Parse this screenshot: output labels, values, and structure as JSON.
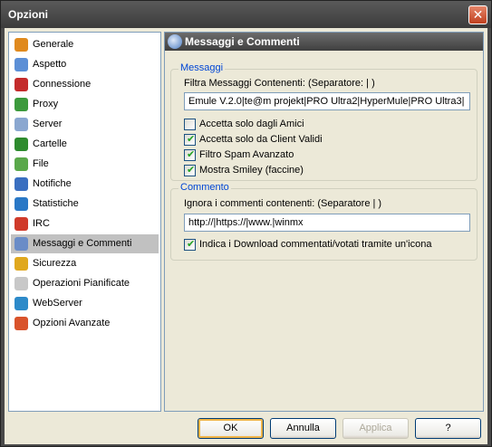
{
  "window": {
    "title": "Opzioni",
    "close_glyph": "✕"
  },
  "nav": {
    "items": [
      {
        "label": "Generale",
        "icon": "gear-icon",
        "color": "#e08a1e"
      },
      {
        "label": "Aspetto",
        "icon": "monitor-icon",
        "color": "#5c8fd6"
      },
      {
        "label": "Connessione",
        "icon": "plug-icon",
        "color": "#c42b2b"
      },
      {
        "label": "Proxy",
        "icon": "proxy-icon",
        "color": "#3c9a3c"
      },
      {
        "label": "Server",
        "icon": "server-icon",
        "color": "#8aa7d0"
      },
      {
        "label": "Cartelle",
        "icon": "folder-icon",
        "color": "#2e8b2e"
      },
      {
        "label": "File",
        "icon": "file-icon",
        "color": "#5aa84a"
      },
      {
        "label": "Notifiche",
        "icon": "notification-icon",
        "color": "#3a6fc0"
      },
      {
        "label": "Statistiche",
        "icon": "statistics-icon",
        "color": "#2a78c6"
      },
      {
        "label": "IRC",
        "icon": "irc-icon",
        "color": "#d03a2a"
      },
      {
        "label": "Messaggi e Commenti",
        "icon": "messages-icon",
        "color": "#6a8cc7"
      },
      {
        "label": "Sicurezza",
        "icon": "lock-icon",
        "color": "#e0a81e"
      },
      {
        "label": "Operazioni Pianificate",
        "icon": "calendar-icon",
        "color": "#c8c8c8"
      },
      {
        "label": "WebServer",
        "icon": "globe-icon",
        "color": "#2d8ac9"
      },
      {
        "label": "Opzioni Avanzate",
        "icon": "advanced-options-icon",
        "color": "#d9532b"
      }
    ],
    "selected_index": 10
  },
  "panel": {
    "title": "Messaggi e Commenti",
    "messages": {
      "legend": "Messaggi",
      "filter_label": "Filtra Messaggi Contenenti: (Separatore: | )",
      "filter_value": "Emule V.2.0|te@m projekt|PRO Ultra2|HyperMule|PRO Ultra3|",
      "checkboxes": [
        {
          "label": "Accetta solo dagli Amici",
          "checked": false
        },
        {
          "label": "Accetta solo da Client Validi",
          "checked": true
        },
        {
          "label": "Filtro Spam Avanzato",
          "checked": true
        },
        {
          "label": "Mostra Smiley (faccine)",
          "checked": true
        }
      ]
    },
    "comments": {
      "legend": "Commento",
      "ignore_label": "Ignora i commenti contenenti: (Separatore | )",
      "ignore_value": "http://|https://|www.|winmx",
      "indicate_label": "Indica i Download commentati/votati tramite un'icona",
      "indicate_checked": true
    }
  },
  "buttons": {
    "ok": "OK",
    "cancel": "Annulla",
    "apply": "Applica",
    "help": "?"
  },
  "check_glyph": "✔"
}
